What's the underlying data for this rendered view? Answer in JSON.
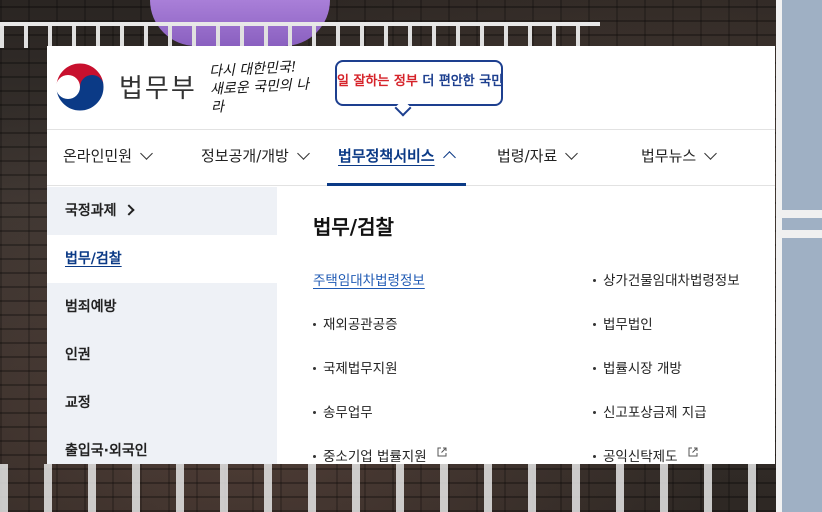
{
  "header": {
    "org_name": "법무부",
    "slogan_line1": "다시 대한민국!",
    "slogan_line2": "새로운 국민의 나라",
    "campaign_red": "일 잘하는 정부",
    "campaign_blue": "더 편안한 국민"
  },
  "gnb": [
    {
      "label": "온라인민원"
    },
    {
      "label": "정보공개/개방"
    },
    {
      "label": "법무정책서비스"
    },
    {
      "label": "법령/자료"
    },
    {
      "label": "법무뉴스"
    }
  ],
  "sidenav": [
    {
      "label": "국정과제"
    },
    {
      "label": "법무/검찰"
    },
    {
      "label": "범죄예방"
    },
    {
      "label": "인권"
    },
    {
      "label": "교정"
    },
    {
      "label": "출입국·외국인"
    }
  ],
  "content": {
    "title": "법무/검찰",
    "links_left": [
      {
        "label": "주택임대차법령정보"
      },
      {
        "label": "재외공관공증"
      },
      {
        "label": "국제법무지원"
      },
      {
        "label": "송무업무"
      },
      {
        "label": "중소기업 법률지원"
      }
    ],
    "links_right": [
      {
        "label": "상가건물임대차법령정보"
      },
      {
        "label": "법무법인"
      },
      {
        "label": "법률시장 개방"
      },
      {
        "label": "신고포상금제 지급"
      },
      {
        "label": "공익신탁제도"
      }
    ]
  },
  "colors": {
    "primary_navy": "#0b3a86",
    "link_blue": "#1f5ab4",
    "campaign_red": "#d6232a",
    "sidenav_bg": "#eef1f6"
  }
}
